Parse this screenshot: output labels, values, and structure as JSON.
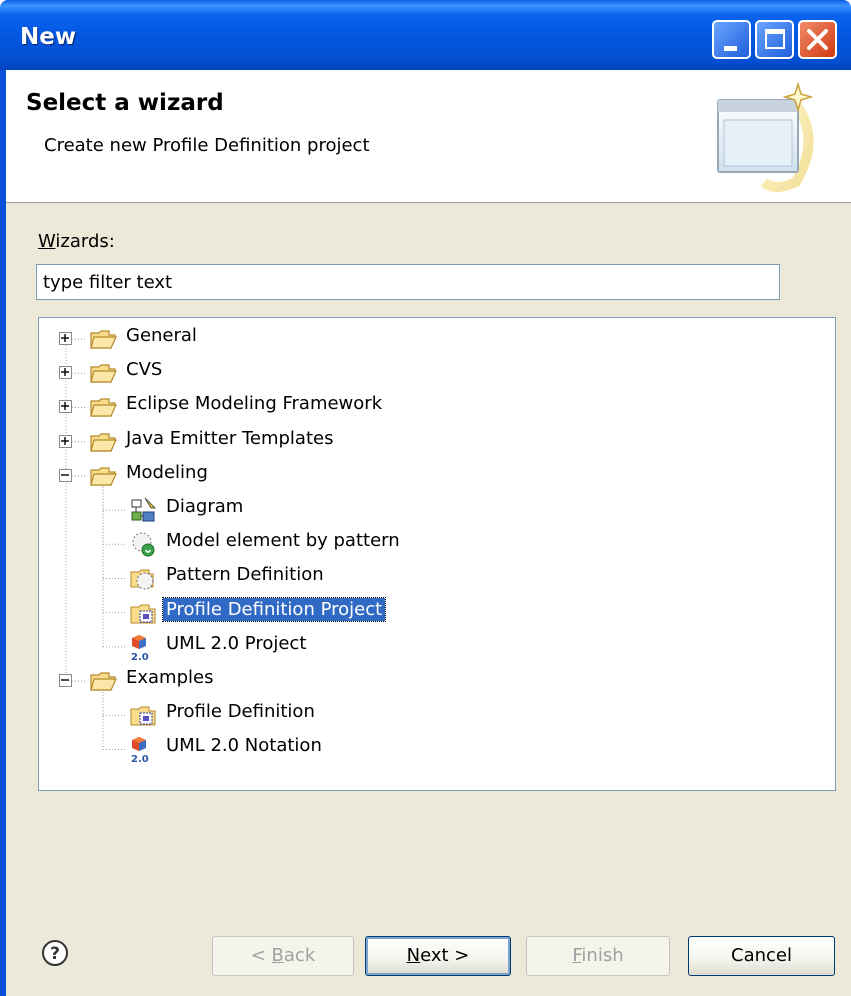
{
  "window": {
    "title": "New"
  },
  "header": {
    "title": "Select a wizard",
    "description": "Create new Profile Definition project"
  },
  "filter": {
    "label_mnemonic": "W",
    "label_rest": "izards:",
    "value": "type filter text"
  },
  "tree": {
    "items": [
      {
        "label": "General",
        "icon": "folder-icon",
        "expanded": false,
        "level": 0
      },
      {
        "label": "CVS",
        "icon": "folder-icon",
        "expanded": false,
        "level": 0
      },
      {
        "label": "Eclipse Modeling Framework",
        "icon": "folder-icon",
        "expanded": false,
        "level": 0
      },
      {
        "label": "Java Emitter Templates",
        "icon": "folder-icon",
        "expanded": false,
        "level": 0
      },
      {
        "label": "Modeling",
        "icon": "folder-icon",
        "expanded": true,
        "level": 0
      },
      {
        "label": "Diagram",
        "icon": "diagram-icon",
        "level": 1
      },
      {
        "label": "Model element by pattern",
        "icon": "pattern-element-icon",
        "level": 1
      },
      {
        "label": "Pattern Definition",
        "icon": "pattern-definition-icon",
        "level": 1
      },
      {
        "label": "Profile Definition Project",
        "icon": "profile-project-icon",
        "level": 1,
        "selected": true
      },
      {
        "label": "UML 2.0 Project",
        "icon": "uml-icon",
        "level": 1
      },
      {
        "label": "Examples",
        "icon": "folder-icon",
        "expanded": true,
        "level": 0
      },
      {
        "label": "Profile Definition",
        "icon": "profile-project-icon",
        "level": 1
      },
      {
        "label": "UML 2.0 Notation",
        "icon": "uml-icon",
        "level": 1
      }
    ],
    "selection_color": "#316ac5"
  },
  "buttons": {
    "back": {
      "mnemonic": "B",
      "prefix": "< ",
      "rest": "ack",
      "enabled": false
    },
    "next": {
      "mnemonic": "N",
      "prefix": "",
      "rest": "ext >",
      "enabled": true
    },
    "finish": {
      "mnemonic": "F",
      "prefix": "",
      "rest": "inish",
      "enabled": false
    },
    "cancel": {
      "label": "Cancel",
      "enabled": true
    }
  },
  "colors": {
    "titlebar": "#0a50d8",
    "dialog_bg": "#ece9d8",
    "folder": "#f2c65b"
  }
}
